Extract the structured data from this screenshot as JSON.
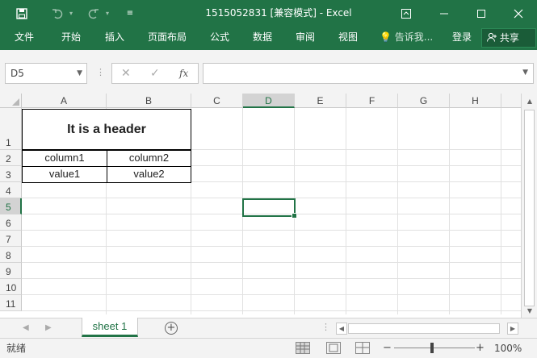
{
  "window": {
    "title": "1515052831  [兼容模式] - Excel",
    "save_icon": "save-icon",
    "undo_icon": "undo-icon",
    "redo_icon": "redo-icon",
    "customize_icon": "customize-quick-access-icon",
    "controls": [
      "ribbon-display-icon",
      "minimize-icon",
      "maximize-icon",
      "close-icon"
    ]
  },
  "ribbon": {
    "tabs": [
      "文件",
      "开始",
      "插入",
      "页面布局",
      "公式",
      "数据",
      "审阅",
      "视图"
    ],
    "tell_me": "告诉我...",
    "login": "登录",
    "share": "共享"
  },
  "formula_bar": {
    "name_box": "D5",
    "fx": "fx",
    "formula": ""
  },
  "grid": {
    "columns": [
      "A",
      "B",
      "C",
      "D",
      "E",
      "F",
      "G",
      "H"
    ],
    "rows": [
      "1",
      "2",
      "3",
      "4",
      "5",
      "6",
      "7",
      "8",
      "9",
      "10",
      "11"
    ],
    "selected_cell": "D5"
  },
  "cells": {
    "header": "It is a header",
    "column1": "column1",
    "column2": "column2",
    "value1": "value1",
    "value2": "value2"
  },
  "sheets": {
    "tabs": [
      "sheet 1"
    ],
    "add": "+"
  },
  "status": {
    "ready": "就绪",
    "zoom_minus": "−",
    "zoom_plus": "+",
    "zoom": "100%"
  },
  "colors": {
    "accent": "#217346",
    "gridline": "#e1e1e1",
    "header_bg": "#f3f3f3"
  }
}
